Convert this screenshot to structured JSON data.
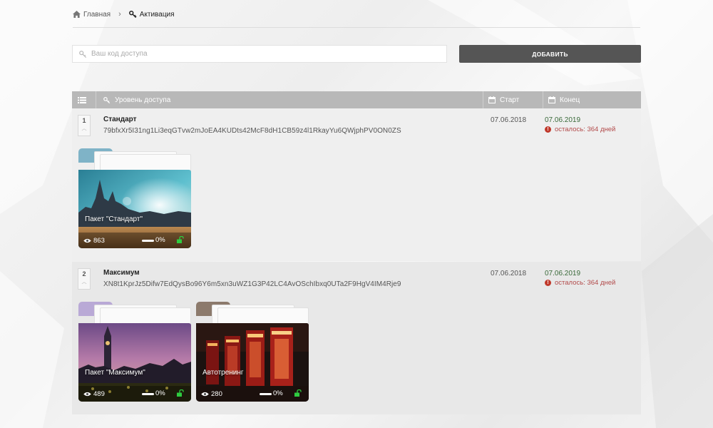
{
  "breadcrumb": {
    "home_label": "Главная",
    "separator": "›",
    "current_label": "Активация"
  },
  "activation": {
    "placeholder": "Ваш код доступа",
    "value": "",
    "add_button_label": "ДОБАВИТЬ"
  },
  "table": {
    "columns": {
      "level": "Уровень доступа",
      "start": "Старт",
      "end": "Конец"
    },
    "rows": [
      {
        "number": "1",
        "name": "Стандарт",
        "code": "79bfxXr5I31ng1Li3eqGTvw2mJoEA4KUDts42McF8dH1CB59z4l1RkayYu6QWjphPV0ON0ZS",
        "start": "07.06.2018",
        "end": "07.06.2019",
        "remaining": "осталось: 364 дней",
        "packages": [
          {
            "title": "Пакет \"Стандарт\"",
            "views": "863",
            "percent": "0%",
            "progress": 0,
            "theme": "teal",
            "icon": "folder-icon"
          }
        ]
      },
      {
        "number": "2",
        "name": "Максимум",
        "code": "XN8t1KprJz5Difw7EdQysBo96Y6m5xn3uWZ1G3P42LC4AvOSchIbxq0UTa2F9HgV4IM4Rje9",
        "start": "07.06.2018",
        "end": "07.06.2019",
        "remaining": "осталось: 364 дней",
        "packages": [
          {
            "title": "Пакет \"Максимум\"",
            "views": "489",
            "percent": "0%",
            "progress": 0,
            "theme": "violet",
            "icon": "folder-icon"
          },
          {
            "title": "Автотренинг",
            "views": "280",
            "percent": "0%",
            "progress": 0,
            "theme": "dark-red",
            "icon": "folder-icon"
          }
        ]
      }
    ]
  },
  "colors": {
    "header_bg": "#b8b8b8",
    "button_bg": "#555555",
    "end_date": "#3a6a3a",
    "warning": "#b24a4a",
    "lock_open": "#2ecc40"
  }
}
